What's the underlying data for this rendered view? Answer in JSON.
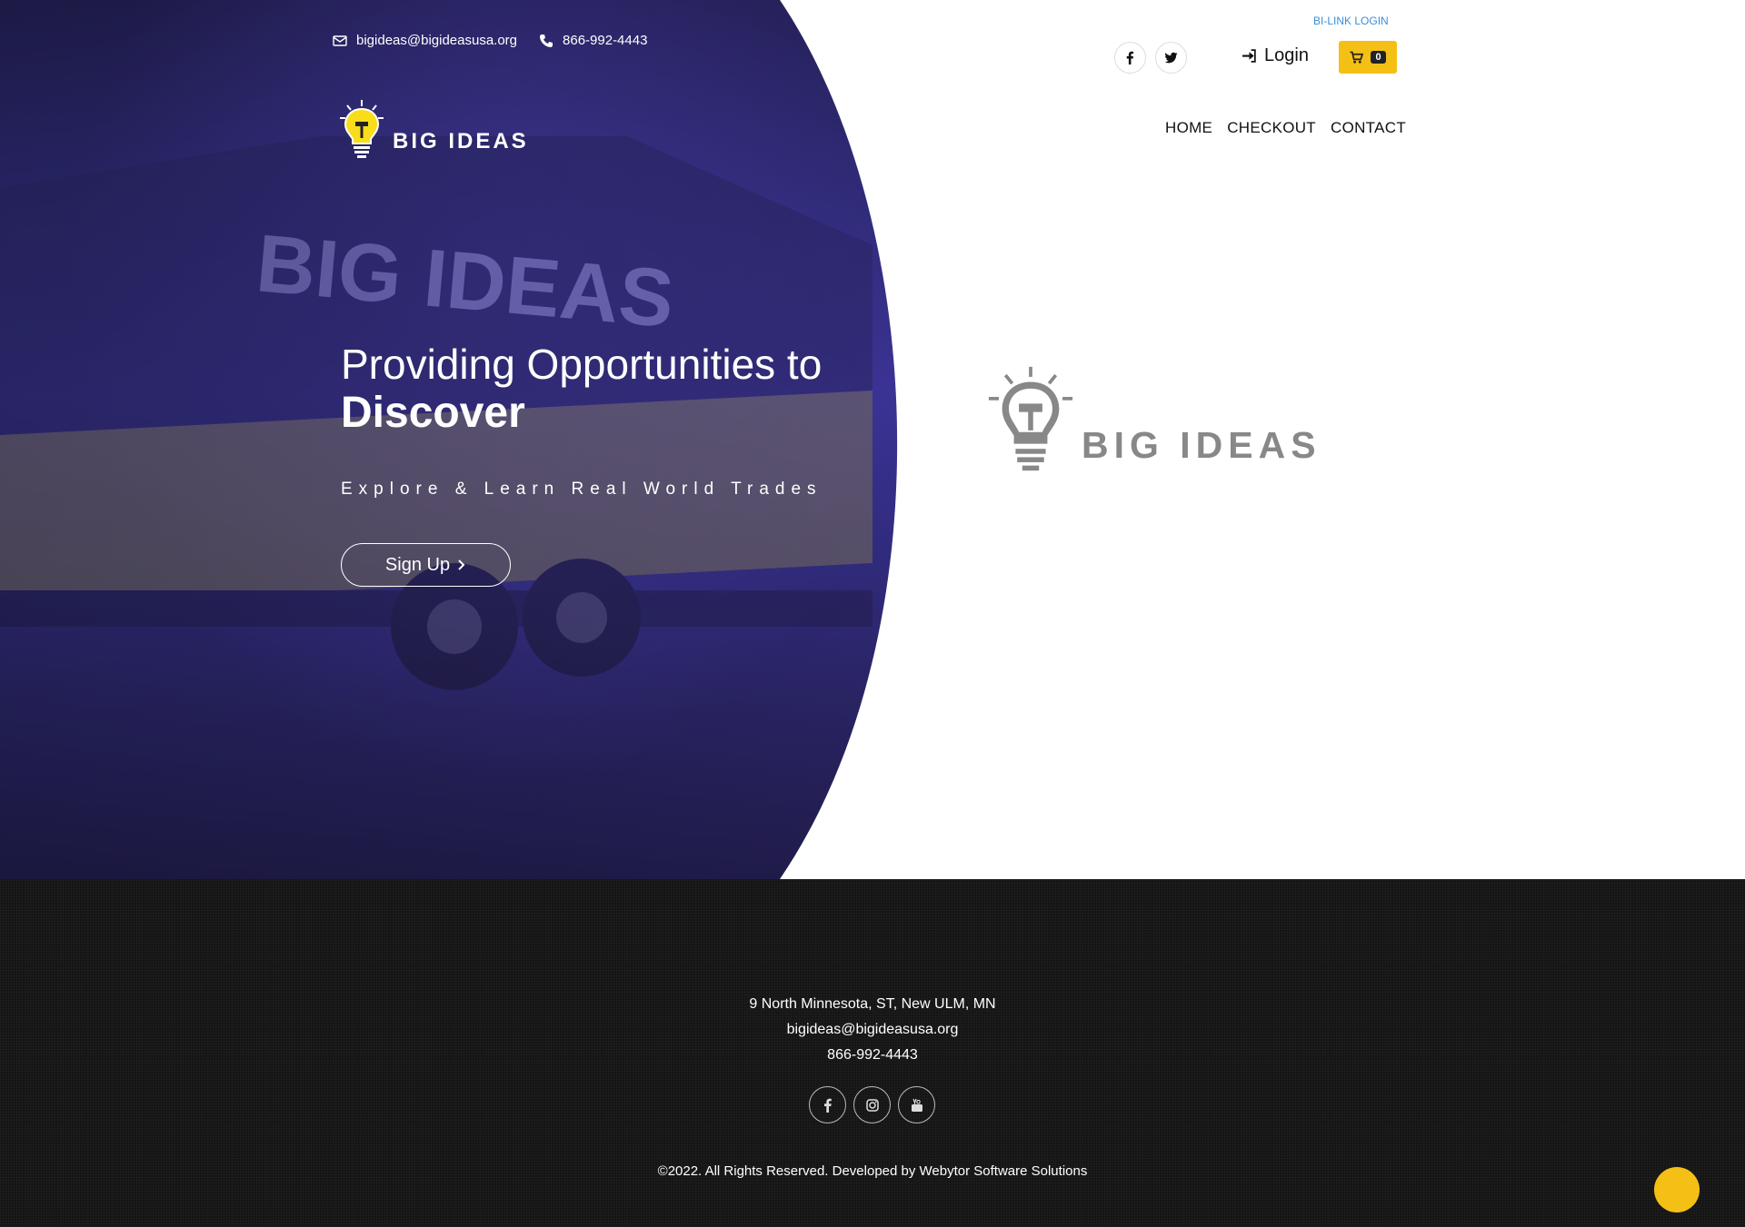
{
  "contact": {
    "email": "bigideas@bigideasusa.org",
    "phone": "866-992-4443"
  },
  "logo": {
    "text": "BIG IDEAS"
  },
  "hero": {
    "title_line1": "Providing Opportunities to",
    "title_line2": "Discover",
    "tagline": "Explore & Learn Real World Trades",
    "signup_label": "Sign Up"
  },
  "header": {
    "bilink_label": "BI-LINK LOGIN",
    "login_label": "Login",
    "cart_count": "0",
    "nav": [
      "HOME",
      "CHECKOUT",
      "CONTACT"
    ]
  },
  "big_logo": {
    "text": "BIG IDEAS"
  },
  "footer": {
    "address": "9 North Minnesota, ST, New ULM, MN",
    "email": "bigideas@bigideasusa.org",
    "phone": "866-992-4443",
    "copyright": "©2022. All Rights Reserved. Developed by  Webytor Software Solutions"
  },
  "colors": {
    "accent": "#f4c016",
    "link": "#3a8fd8",
    "footer_bg": "#151515",
    "hero_bg": "#2f2c78"
  },
  "icons": {
    "email": "envelope-icon",
    "phone": "phone-icon",
    "facebook": "facebook-icon",
    "twitter": "twitter-icon",
    "instagram": "instagram-icon",
    "youtube": "youtube-icon",
    "login": "sign-in-icon",
    "cart": "cart-icon"
  }
}
